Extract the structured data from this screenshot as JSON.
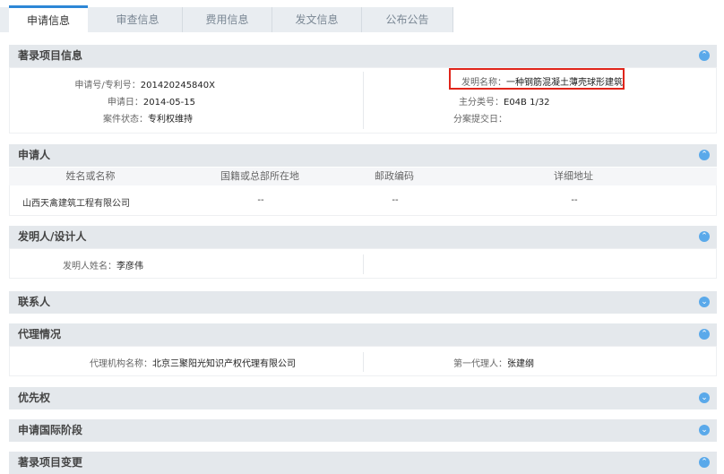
{
  "tabs": [
    "申请信息",
    "审查信息",
    "费用信息",
    "发文信息",
    "公布公告"
  ],
  "bibliographic": {
    "title": "著录项目信息",
    "app_no_label": "申请号/专利号：",
    "app_no_value": "201420245840X",
    "app_date_label": "申请日：",
    "app_date_value": "2014-05-15",
    "status_label": "案件状态：",
    "status_value": "专利权维持",
    "invention_label": "发明名称：",
    "invention_value": "一种钢筋混凝土薄壳球形建筑",
    "main_class_label": "主分类号：",
    "main_class_value": "E04B 1/32",
    "divisional_label": "分案提交日："
  },
  "applicant": {
    "title": "申请人",
    "columns": [
      "姓名或名称",
      "国籍或总部所在地",
      "邮政编码",
      "详细地址"
    ],
    "row": [
      "山西天禽建筑工程有限公司",
      "--",
      "--",
      "--"
    ]
  },
  "inventor": {
    "title": "发明人/设计人",
    "name_label": "发明人姓名：",
    "name_value": "李彦伟"
  },
  "contact": {
    "title": "联系人"
  },
  "agency": {
    "title": "代理情况",
    "org_label": "代理机构名称：",
    "org_value": "北京三聚阳光知识产权代理有限公司",
    "agent_label": "第一代理人：",
    "agent_value": "张建纲"
  },
  "priority": {
    "title": "优先权"
  },
  "intl_stage": {
    "title": "申请国际阶段"
  },
  "bib_change": {
    "title": "著录项目变更"
  },
  "icons": {
    "collapse": "chevron-up-icon",
    "expand": "chevron-down-icon"
  },
  "colors": {
    "accent": "#2d87d6",
    "highlight": "#e0251b",
    "toggle": "#5aa9ea"
  }
}
